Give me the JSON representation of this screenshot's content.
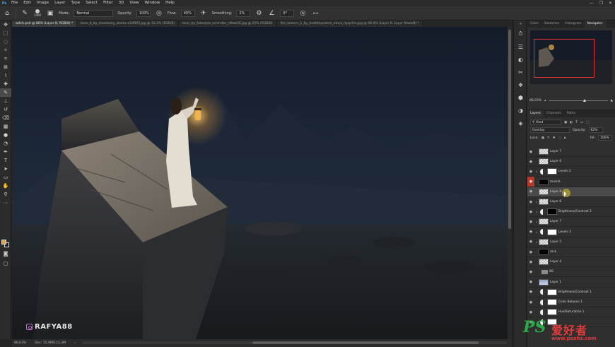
{
  "app": {
    "logo": "Ps"
  },
  "menu": [
    "File",
    "Edit",
    "Image",
    "Layer",
    "Type",
    "Select",
    "Filter",
    "3D",
    "View",
    "Window",
    "Help"
  ],
  "window_controls": [
    "—",
    "❐",
    "✕"
  ],
  "options": {
    "brush_size": "1400",
    "mode_label": "Mode:",
    "mode_value": "Normal",
    "opacity_label": "Opacity:",
    "opacity_value": "100%",
    "flow_label": "Flow:",
    "flow_value": "40%",
    "smoothing_label": "Smoothing:",
    "smoothing_value": "2%",
    "angle_value": "0°"
  },
  "document_tabs": [
    "witch.psd @ 86% (Layer 8, RGB/8) *",
    "bear_6_by_dreadamy_stocks-d24f8f3.jpg @ 33,3% (RGB/8)",
    "bear_by_fotostyle_schindler_d9wk56.jpg @ 25% (RGB/8)",
    "the_lantern_1_by_deathbycomm_stock_dyqv5m.jpg @ 46,4% (Layer 0, Layer Mask/8) *"
  ],
  "canvas": {
    "watermark": "RAFYA88"
  },
  "status": {
    "zoom": "86,03%",
    "doc": "Doc: 15,9M/115,3M",
    "arrow": "›"
  },
  "navigator": {
    "tabs": [
      "Color",
      "Swatches",
      "Histogram",
      "Navigator"
    ],
    "active_tab": 3,
    "zoom": "86,03%"
  },
  "layers_panel": {
    "tabs": [
      "Layers",
      "Channels",
      "Paths"
    ],
    "active_tab": 0,
    "filter_kind": "Kind",
    "blend_mode": "Overlay",
    "opacity_label": "Opacity:",
    "opacity_value": "62%",
    "lock_label": "Lock:",
    "fill_label": "Fill:",
    "fill_value": "100%",
    "layers": [
      {
        "name": "Layer 7",
        "thumb": "a",
        "eye": "normal",
        "clip": false
      },
      {
        "name": "Layer 6",
        "thumb": "a",
        "eye": "normal",
        "clip": false
      },
      {
        "name": "Levels 2",
        "thumb": "w",
        "eye": "normal",
        "clip": true,
        "adjustment": true
      },
      {
        "name": "musial..",
        "thumb": "b",
        "eye": "red",
        "clip": false
      },
      {
        "name": "Layer 8",
        "thumb": "a",
        "eye": "normal",
        "clip": false,
        "selected": true
      },
      {
        "name": "Layer 8",
        "thumb": "a",
        "eye": "normal",
        "clip": true
      },
      {
        "name": "Brightness/Contrast 2",
        "thumb": "b",
        "eye": "normal",
        "clip": true,
        "adjustment": true
      },
      {
        "name": "Layer 7",
        "thumb": "a",
        "eye": "normal",
        "clip": true
      },
      {
        "name": "Levels 3",
        "thumb": "w",
        "eye": "normal",
        "clip": true,
        "adjustment": true
      },
      {
        "name": "Layer 5",
        "thumb": "a",
        "eye": "normal",
        "clip": true
      },
      {
        "name": "rock",
        "thumb": "b",
        "eye": "normal",
        "clip": false
      },
      {
        "name": "Layer 4",
        "thumb": "a",
        "eye": "normal",
        "clip": false
      },
      {
        "name": "BG",
        "thumb": "folder",
        "eye": "normal",
        "clip": false
      },
      {
        "name": "Layer 1",
        "thumb": "sky",
        "eye": "normal",
        "clip": false
      },
      {
        "name": "Brightness/Contrast 1",
        "thumb": "w",
        "eye": "normal",
        "clip": false,
        "adjustment": true
      },
      {
        "name": "Color Balance 1",
        "thumb": "w",
        "eye": "normal",
        "clip": false,
        "adjustment": true
      },
      {
        "name": "Hue/Saturation 1",
        "thumb": "w",
        "eye": "normal",
        "clip": false,
        "adjustment": true
      },
      {
        "name": "",
        "thumb": "w",
        "eye": "normal",
        "clip": false,
        "adjustment": true
      }
    ]
  },
  "site_watermark": {
    "big": "PS",
    "cn": "爱好者",
    "url": "www.psahz.com"
  },
  "colors": {
    "foreground": "#f0a030",
    "background": "#1b1b1b",
    "selected_layer": "#4a4a4a"
  }
}
